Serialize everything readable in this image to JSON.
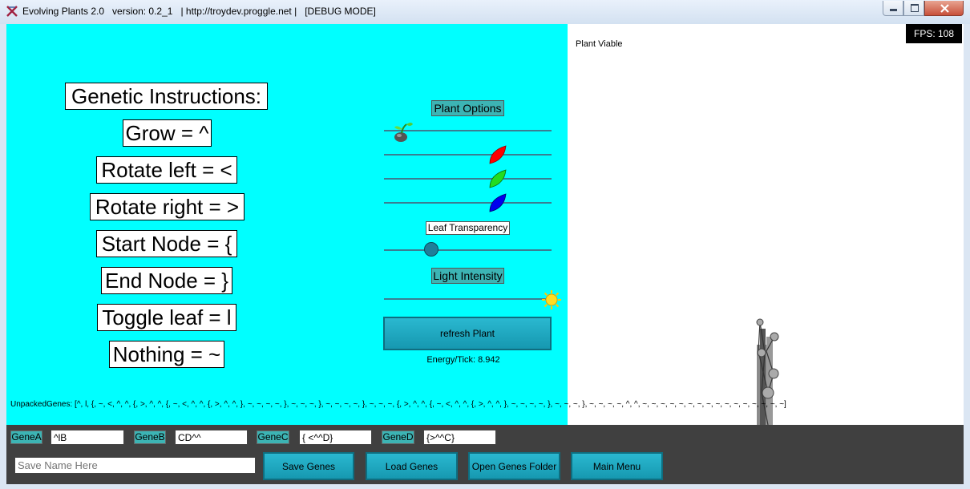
{
  "window": {
    "title": "Evolving Plants 2.0   version: 0.2_1   | http://troydev.proggle.net |   [DEBUG MODE]"
  },
  "instructions": {
    "title": "Genetic Instructions:",
    "grow": "Grow = ^",
    "rotate_left": "Rotate left = <",
    "rotate_right": "Rotate right = >",
    "start_node": "Start Node = {",
    "end_node": "End Node = }",
    "toggle_leaf": "Toggle leaf = l",
    "nothing": "Nothing = ~"
  },
  "options": {
    "plant_options_label": "Plant Options",
    "leaf_transparency_label": "Leaf Transparency",
    "light_intensity_label": "Light Intensity",
    "refresh_label": "refresh Plant",
    "energy": "Energy/Tick: 8.942",
    "sliders": {
      "seed": 0.09,
      "red": 0.68,
      "green": 0.68,
      "blue": 0.68,
      "leaf_transparency": 0.29,
      "light_intensity": 1.0
    },
    "colors": {
      "red": "#ff0000",
      "green": "#22dd22",
      "blue": "#0000ee",
      "accent": "#00ffff"
    }
  },
  "unpacked_genes": "UnpackedGenes: [^, l, {, ~, <, ^, ^, {, >, ^, ^, {, ~, <, ^, ^, {, >, ^, ^, }, ~, ~, ~, ~, }, ~, ~, ~, }, ~, ~, ~, ~, }, ~, ~, ~, {, >, ^, ^, {, ~, <, ^, ^, {, >, ^, ^, }, ~, ~, ~, ~, }, ~, ~, ~, }, ~, ~, ~, ~, ^, ^, ~, ~, ~, ~, ~, ~, ~, ~, ~, ~, ~, ~, ~, ~, ~, ~]",
  "viewer": {
    "status": "Plant Viable",
    "fps": "FPS: 108"
  },
  "genes": {
    "a_label": "GeneA",
    "a_value": "^lB",
    "b_label": "GeneB",
    "b_value": "CD^^",
    "c_label": "GeneC",
    "c_value": "{ <^^D}",
    "d_label": "GeneD",
    "d_value": "{>^^C}",
    "save_name_placeholder": "Save Name Here"
  },
  "buttons": {
    "save": "Save Genes",
    "load": "Load Genes",
    "open_folder": "Open Genes Folder",
    "main_menu": "Main Menu"
  }
}
